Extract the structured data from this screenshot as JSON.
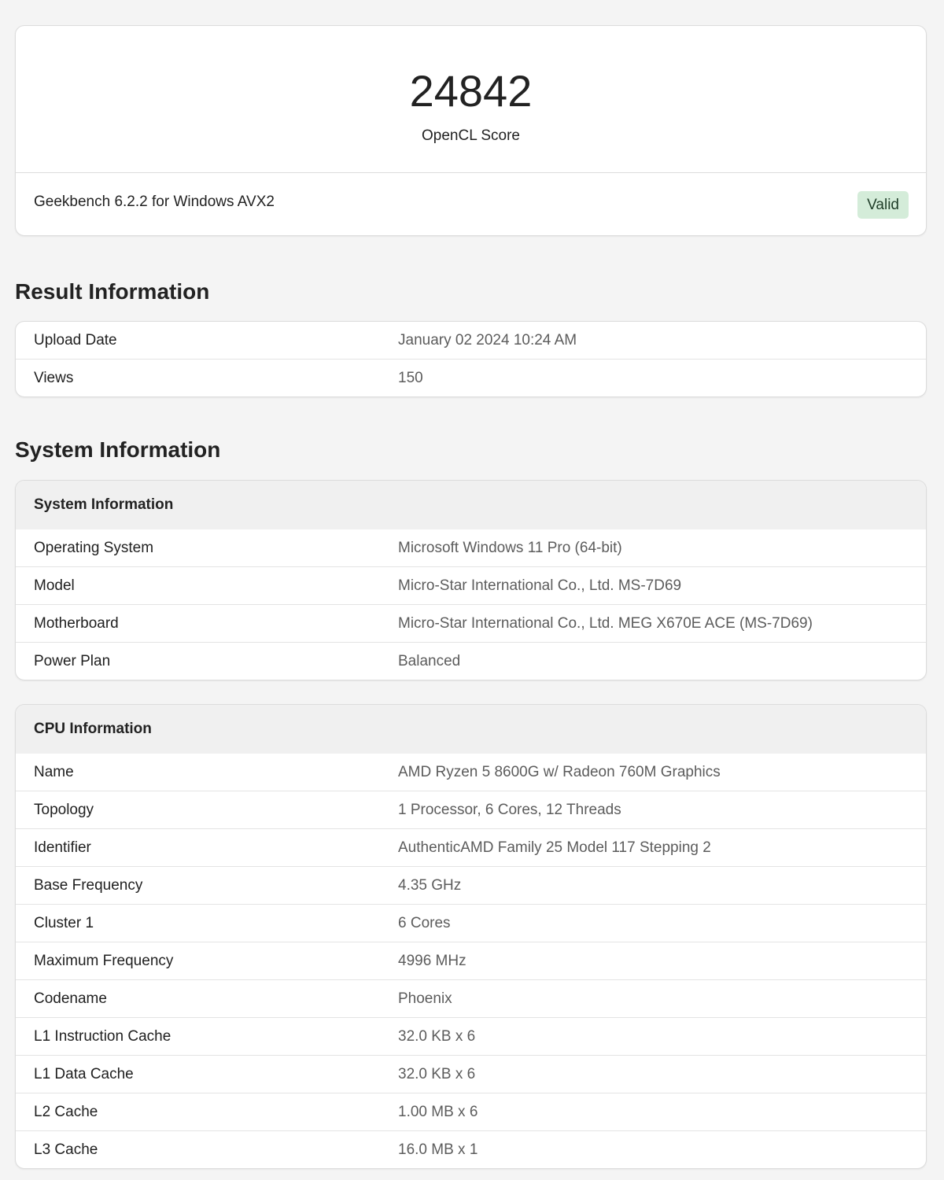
{
  "score": {
    "value": "24842",
    "label": "OpenCL Score"
  },
  "version": "Geekbench 6.2.2 for Windows AVX2",
  "status_badge": "Valid",
  "colors": {
    "valid_badge_bg": "#d4ecd9",
    "page_bg": "#f4f4f4"
  },
  "result_section": {
    "title": "Result Information",
    "rows": [
      {
        "key": "Upload Date",
        "value": "January 02 2024 10:24 AM"
      },
      {
        "key": "Views",
        "value": "150"
      }
    ]
  },
  "system_section": {
    "title": "System Information",
    "system_card": {
      "heading": "System Information",
      "rows": [
        {
          "key": "Operating System",
          "value": "Microsoft Windows 11 Pro (64-bit)"
        },
        {
          "key": "Model",
          "value": "Micro-Star International Co., Ltd. MS-7D69"
        },
        {
          "key": "Motherboard",
          "value": "Micro-Star International Co., Ltd. MEG X670E ACE (MS-7D69)"
        },
        {
          "key": "Power Plan",
          "value": "Balanced"
        }
      ]
    },
    "cpu_card": {
      "heading": "CPU Information",
      "rows": [
        {
          "key": "Name",
          "value": "AMD Ryzen 5 8600G w/ Radeon 760M Graphics"
        },
        {
          "key": "Topology",
          "value": "1 Processor, 6 Cores, 12 Threads"
        },
        {
          "key": "Identifier",
          "value": "AuthenticAMD Family 25 Model 117 Stepping 2"
        },
        {
          "key": "Base Frequency",
          "value": "4.35 GHz"
        },
        {
          "key": "Cluster 1",
          "value": "6 Cores"
        },
        {
          "key": "Maximum Frequency",
          "value": "4996 MHz"
        },
        {
          "key": "Codename",
          "value": "Phoenix"
        },
        {
          "key": "L1 Instruction Cache",
          "value": "32.0 KB x 6"
        },
        {
          "key": "L1 Data Cache",
          "value": "32.0 KB x 6"
        },
        {
          "key": "L2 Cache",
          "value": "1.00 MB x 6"
        },
        {
          "key": "L3 Cache",
          "value": "16.0 MB x 1"
        }
      ]
    }
  }
}
